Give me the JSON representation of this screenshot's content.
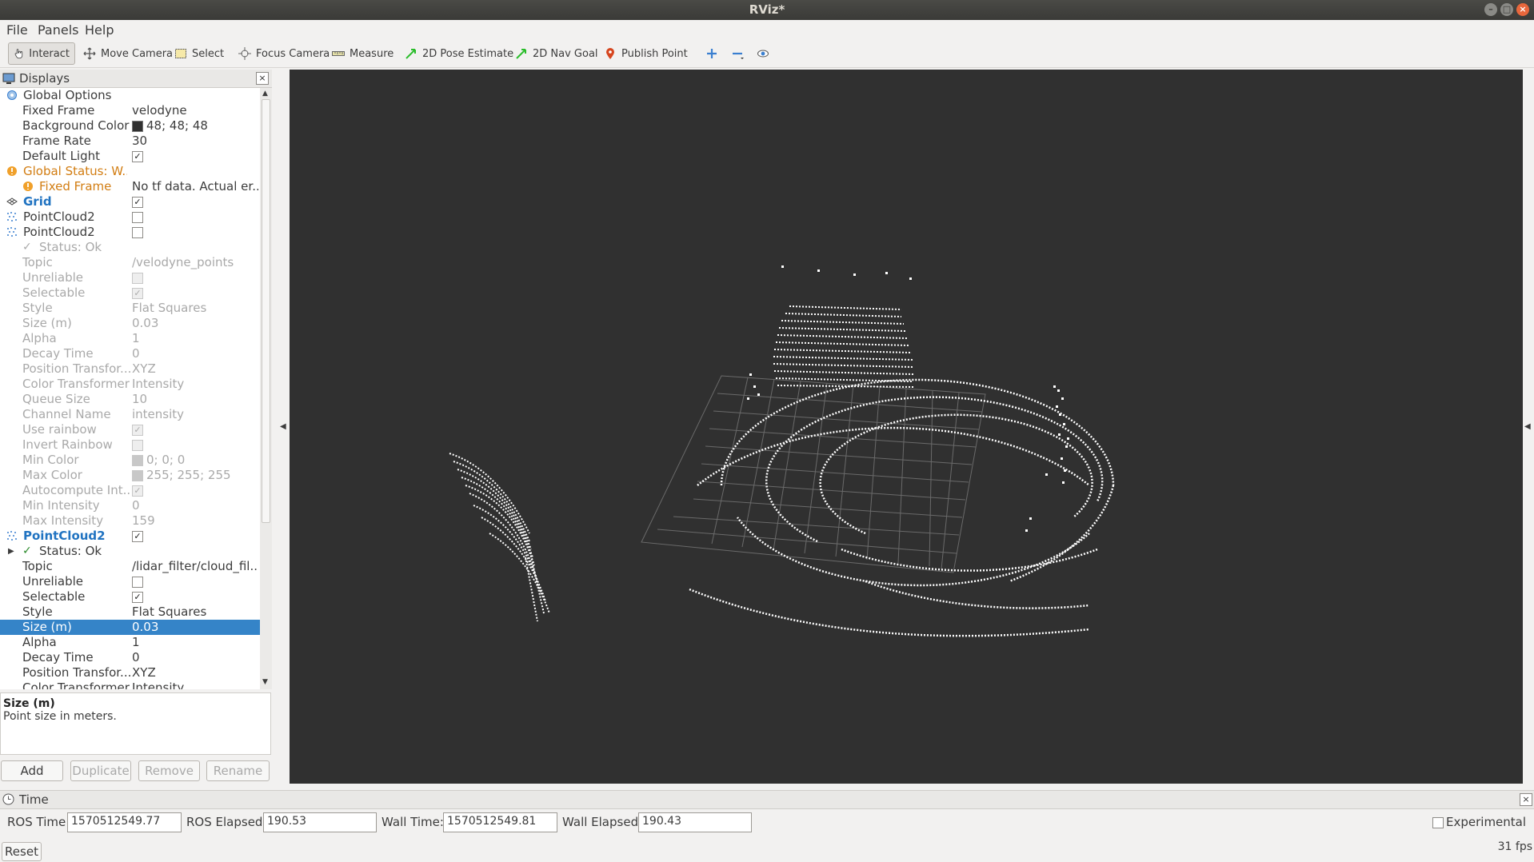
{
  "window": {
    "title": "RViz*"
  },
  "menu": [
    "File",
    "Panels",
    "Help"
  ],
  "toolbar": {
    "tools": [
      "Interact",
      "Move Camera",
      "Select",
      "Focus Camera",
      "Measure",
      "2D Pose Estimate",
      "2D Nav Goal",
      "Publish Point"
    ]
  },
  "displays": {
    "title": "Displays",
    "rows": [
      {
        "label": "Global Options",
        "value": ""
      },
      {
        "label": "Fixed Frame",
        "value": "velodyne"
      },
      {
        "label": "Background Color",
        "value": "48; 48; 48"
      },
      {
        "label": "Frame Rate",
        "value": "30"
      },
      {
        "label": "Default Light",
        "value": ""
      },
      {
        "label": "Global Status: W...",
        "value": ""
      },
      {
        "label": "Fixed Frame",
        "value": "No tf data.  Actual er..."
      },
      {
        "label": "Grid",
        "value": ""
      },
      {
        "label": "PointCloud2",
        "value": ""
      },
      {
        "label": "PointCloud2",
        "value": ""
      },
      {
        "label": "Status: Ok",
        "value": ""
      },
      {
        "label": "Topic",
        "value": "/velodyne_points"
      },
      {
        "label": "Unreliable",
        "value": ""
      },
      {
        "label": "Selectable",
        "value": ""
      },
      {
        "label": "Style",
        "value": "Flat Squares"
      },
      {
        "label": "Size (m)",
        "value": "0.03"
      },
      {
        "label": "Alpha",
        "value": "1"
      },
      {
        "label": "Decay Time",
        "value": "0"
      },
      {
        "label": "Position Transfor...",
        "value": "XYZ"
      },
      {
        "label": "Color Transformer",
        "value": "Intensity"
      },
      {
        "label": "Queue Size",
        "value": "10"
      },
      {
        "label": "Channel Name",
        "value": "intensity"
      },
      {
        "label": "Use rainbow",
        "value": ""
      },
      {
        "label": "Invert Rainbow",
        "value": ""
      },
      {
        "label": "Min Color",
        "value": "0; 0; 0"
      },
      {
        "label": "Max Color",
        "value": "255; 255; 255"
      },
      {
        "label": "Autocompute Int...",
        "value": ""
      },
      {
        "label": "Min Intensity",
        "value": "0"
      },
      {
        "label": "Max Intensity",
        "value": "159"
      },
      {
        "label": "PointCloud2",
        "value": ""
      },
      {
        "label": "Status: Ok",
        "value": ""
      },
      {
        "label": "Topic",
        "value": "/lidar_filter/cloud_fil..."
      },
      {
        "label": "Unreliable",
        "value": ""
      },
      {
        "label": "Selectable",
        "value": ""
      },
      {
        "label": "Style",
        "value": "Flat Squares"
      },
      {
        "label": "Size (m)",
        "value": "0.03"
      },
      {
        "label": "Alpha",
        "value": "1"
      },
      {
        "label": "Decay Time",
        "value": "0"
      },
      {
        "label": "Position Transfor...",
        "value": "XYZ"
      },
      {
        "label": "Color Transformer",
        "value": "Intensity"
      }
    ],
    "description": {
      "title": "Size (m)",
      "text": "Point size in meters."
    },
    "buttons": [
      "Add",
      "Duplicate",
      "Remove",
      "Rename"
    ]
  },
  "time": {
    "title": "Time",
    "ros_time_label": "ROS Time:",
    "ros_time": "1570512549.77",
    "ros_elapsed_label": "ROS Elapsed:",
    "ros_elapsed": "190.53",
    "wall_time_label": "Wall Time:",
    "wall_time": "1570512549.81",
    "wall_elapsed_label": "Wall Elapsed:",
    "wall_elapsed": "190.43",
    "experimental_label": "Experimental",
    "reset_label": "Reset",
    "fps": "31 fps"
  },
  "colors": {
    "background": "#303030",
    "selection": "#3584c8",
    "warning": "#d27d12",
    "accent_blue": "#2073c1"
  }
}
